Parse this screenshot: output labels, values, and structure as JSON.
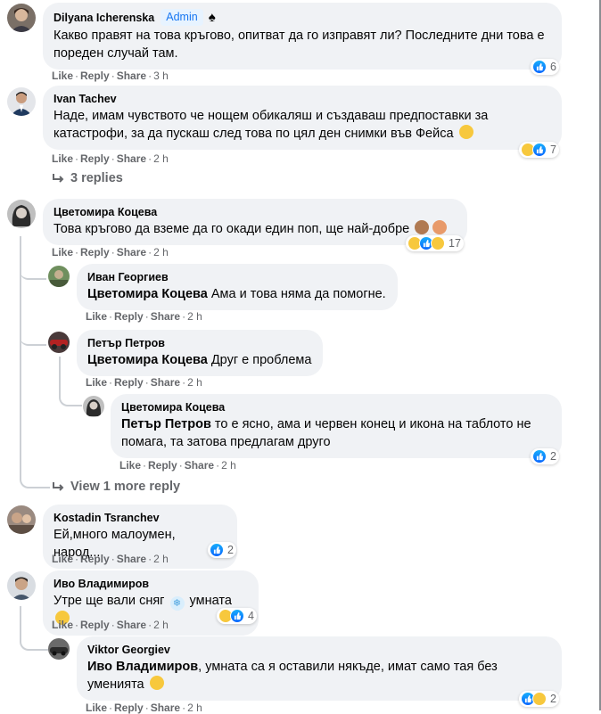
{
  "comments": [
    {
      "name": "Dilyana Icherenska",
      "badge": "Admin",
      "text": "Какво правят на това кръгово, опитват да го изправят ли? Последните дни това е пореден случай там.",
      "like": "Like",
      "reply": "Reply",
      "share": "Share",
      "time": "3 h",
      "reaction_count": "6"
    },
    {
      "name": "Ivan Tachev",
      "text": "Наде, имам чувството че нощем обикаляш и създаваш предпоставки за катастрофи, за да пускаш след това по цял ден снимки във Фейса",
      "like": "Like",
      "reply": "Reply",
      "share": "Share",
      "time": "2 h",
      "reaction_count": "7",
      "replies_link": "3 replies"
    },
    {
      "name": "Цветомира Коцева",
      "text": "Това кръгово да вземе да го окади един поп, ще най-добре",
      "like": "Like",
      "reply": "Reply",
      "share": "Share",
      "time": "2 h",
      "reaction_count": "17"
    },
    {
      "name": "Иван Георгиев",
      "mention": "Цветомира Коцева",
      "text": " Ама и това няма да помогне.",
      "like": "Like",
      "reply": "Reply",
      "share": "Share",
      "time": "2 h"
    },
    {
      "name": "Петър Петров",
      "mention": "Цветомира Коцева",
      "text": " Друг е проблема",
      "like": "Like",
      "reply": "Reply",
      "share": "Share",
      "time": "2 h"
    },
    {
      "name": "Цветомира Коцева",
      "mention": "Петър Петров",
      "text": " то е ясно, ама и червен конец и икона на таблото не помага, та затова предлагам друго",
      "like": "Like",
      "reply": "Reply",
      "share": "Share",
      "time": "2 h",
      "reaction_count": "2"
    },
    {
      "name": "Kostadin Tsranchev",
      "text": "Ей,много малоумен, народ....",
      "like": "Like",
      "reply": "Reply",
      "share": "Share",
      "time": "2 h",
      "reaction_count": "2"
    },
    {
      "name": "Иво Владимиров",
      "text_a": "Утре ще вали сняг ",
      "text_b": " умната ",
      "like": "Like",
      "reply": "Reply",
      "share": "Share",
      "time": "2 h",
      "reaction_count": "4"
    },
    {
      "name": "Viktor Georgiev",
      "mention": "Иво Владимиров",
      "text": ", умната са я оставили някъде, имат само тая без уменията",
      "like": "Like",
      "reply": "Reply",
      "share": "Share",
      "time": "2 h",
      "reaction_count": "2"
    }
  ],
  "view_more": "View 1 more reply",
  "separator": "·",
  "colors": {
    "bubble": "#f0f2f5",
    "meta": "#65676b",
    "link": "#1877f2",
    "like_reaction": "#0866ff",
    "haha_reaction": "#f7c83d"
  }
}
